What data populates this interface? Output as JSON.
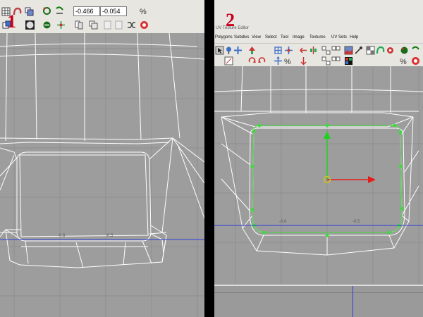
{
  "left": {
    "step_label": "1",
    "field_u": "-0.466",
    "field_v": "-0.054",
    "tick_labels": [
      "-0.6",
      "-0.5"
    ],
    "icons": [
      "grid-icon",
      "magnet-icon",
      "copy-icon",
      "cut-icon",
      "paste-icon",
      "rotate-icon",
      "flip-icon",
      "percent-icon",
      "layout-icon",
      "sphere-icon",
      "sew-icon",
      "move-icon",
      "unfold-icon",
      "relax-icon",
      "snapshot-icon",
      "stop-icon"
    ]
  },
  "right": {
    "step_label": "2",
    "window_title": "UV Texture Editor",
    "menu": [
      "Polygons",
      "Subdivs",
      "View",
      "Select",
      "Tool",
      "Image",
      "Textures",
      "UV Sets",
      "Help"
    ],
    "tick_labels": [
      "-0.6",
      "-0.5"
    ],
    "icons": [
      "select-icon",
      "pin-icon",
      "frame-icon",
      "arrow-up-icon",
      "grid-icon",
      "snap-icon",
      "flip-icon",
      "rotate-cw-icon",
      "rotate-ccw-icon",
      "move-left-icon",
      "layout-icon",
      "cut-icon",
      "sew-icon",
      "image-icon",
      "uv-dist-icon",
      "magnet-icon",
      "gear-icon",
      "checker-icon",
      "color-icon",
      "percent-icon",
      "stop-icon"
    ]
  },
  "colors": {
    "viewport": "#9d9d9d",
    "wire": "#ffffff",
    "axis_line": "#2f3dd8",
    "selection": "#3bdc3b",
    "move_x": "#e41c1c",
    "move_y": "#1ed21e",
    "pivot": "#d6c51d",
    "step_label": "#c8001a"
  }
}
